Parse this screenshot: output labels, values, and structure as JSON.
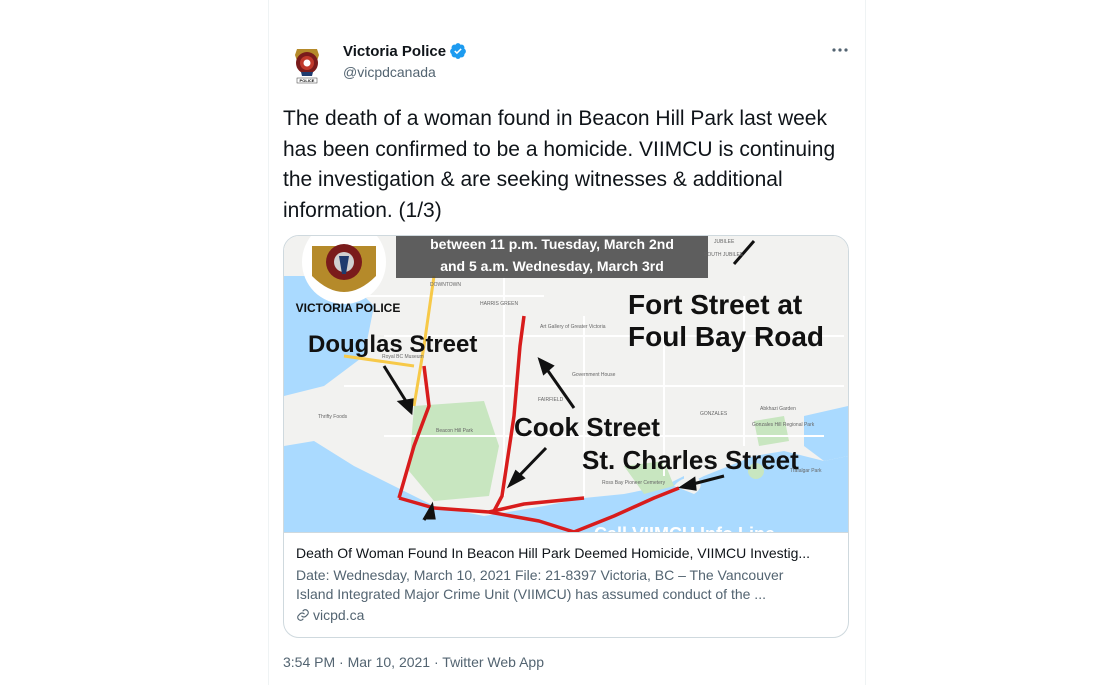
{
  "author": {
    "display_name": "Victoria Police",
    "handle": "@vicpdcanada",
    "verified_icon": "verified-badge-icon",
    "avatar_icon": "victoria-police-crest"
  },
  "tweet": {
    "text": "The death of a woman found in Beacon Hill Park last week has been confirmed to be a homicide. VIIMCU is continuing the investigation & are seeking witnesses & additional information. (1/3)"
  },
  "card": {
    "image": {
      "crest_text": "VICTORIA POLICE",
      "banner_line_1": "between 11 p.m. Tuesday, March 2nd",
      "banner_line_2": "and 5 a.m. Wednesday, March 3rd",
      "label_fort": "Fort Street at",
      "label_foulbay": "Foul Bay Road",
      "label_douglas": "Douglas Street",
      "label_cook": "Cook Street",
      "label_stcharles": "St. Charles Street",
      "bottom_partial": "Call VIIMCU Info Line",
      "map_labels": {
        "downtown": "DOWNTOWN",
        "harris_green": "HARRIS GREEN",
        "fairfield": "FAIRFIELD",
        "gonzales": "GONZALES",
        "jubilee": "JUBILEE",
        "south_jubilee": "SOUTH JUBILEE",
        "beacon_hill": "Beacon Hill Park",
        "government_house": "Government House",
        "art_gallery": "Art Gallery of Greater Victoria",
        "abkhazi": "Abkhazi Garden",
        "gonzales_hill": "Gonzales Hill Regional Park",
        "trafalgar": "Trafalgar Park",
        "ross_bay": "Ross Bay Pioneer Cemetery",
        "bc_museum": "Royal BC Museum",
        "thrifty": "Thrifty Foods"
      }
    },
    "title": "Death Of Woman Found In Beacon Hill Park Deemed Homicide, VIIMCU Investig...",
    "description": "Date: Wednesday, March 10, 2021 File: 21-8397 Victoria, BC – The Vancouver Island Integrated Major Crime Unit (VIIMCU) has assumed conduct of the ...",
    "domain": "vicpd.ca",
    "domain_icon": "link-icon"
  },
  "meta": {
    "time": "3:54 PM",
    "separator": "·",
    "date": "Mar 10, 2021",
    "separator2": "·",
    "source": "Twitter Web App"
  },
  "colors": {
    "accent": "#1d9bf0",
    "route_red": "#d81c1c",
    "map_water": "#aadaff",
    "map_land": "#f2f2f0",
    "map_park": "#c8e6c0"
  }
}
